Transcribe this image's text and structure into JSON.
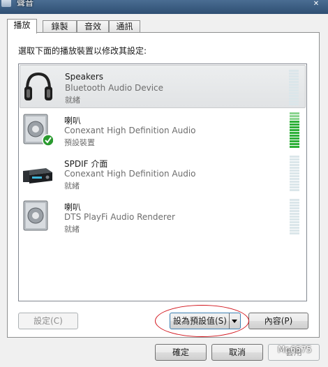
{
  "window": {
    "title": "聲音",
    "close_glyph": "✕"
  },
  "tabs": [
    {
      "label": "播放",
      "active": true
    },
    {
      "label": "錄製",
      "active": false
    },
    {
      "label": "音效",
      "active": false
    },
    {
      "label": "通訊",
      "active": false
    }
  ],
  "instruction": "選取下面的播放裝置以修改其設定:",
  "devices": [
    {
      "name": "Speakers",
      "description": "Bluetooth Audio Device",
      "status": "就緒",
      "icon": "headphones-icon",
      "selected": true,
      "level_bars_lit": 0
    },
    {
      "name": "喇叭",
      "description": "Conexant High Definition Audio",
      "status": "預設裝置",
      "icon": "speaker-icon",
      "default": true,
      "level_bars_lit": 10
    },
    {
      "name": "SPDIF 介面",
      "description": "Conexant High Definition Audio",
      "status": "就緒",
      "icon": "receiver-icon",
      "level_bars_lit": 0
    },
    {
      "name": "喇叭",
      "description": "DTS PlayFi Audio Renderer",
      "status": "就緒",
      "icon": "speaker-icon",
      "level_bars_lit": 0
    }
  ],
  "buttons": {
    "configure": "設定(C)",
    "set_default": "設為預設值(S)",
    "properties": "內容(P)",
    "ok": "確定",
    "cancel": "取消",
    "apply": "套用"
  },
  "watermark": "Mr.6575"
}
